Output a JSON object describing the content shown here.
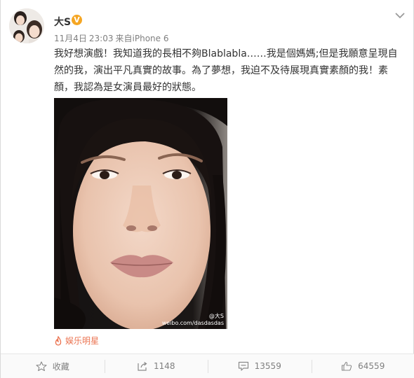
{
  "user": {
    "name": "大S",
    "verified_badge": "V"
  },
  "meta": {
    "date": "11月4日",
    "time": "23:03",
    "via_prefix": "来自",
    "device": "iPhone 6"
  },
  "post": {
    "text": "我好想演戲！我知道我的長相不夠Blablabla……我是個媽媽;但是我願意呈現自然的我，演出平凡真實的故事。為了夢想，我迫不及待展現真實素顏的我！素顏，我認為是女演員最好的狀態。"
  },
  "image": {
    "watermark_handle": "@大S",
    "watermark_url": "weibo.com/dasdasdas"
  },
  "source_tag": {
    "label": "娱乐明星"
  },
  "actions": {
    "favorite_label": "收藏",
    "repost_count": "1148",
    "comment_count": "13559",
    "like_count": "64559"
  },
  "colors": {
    "source_tag": "#eb7350",
    "verified_badge": "#f5a623",
    "meta_text": "#808080"
  },
  "icons": {
    "more": "chevron-down-icon",
    "source": "flame-icon",
    "favorite": "star-icon",
    "repost": "share-icon",
    "comment": "comment-icon",
    "like": "thumbs-up-icon"
  }
}
